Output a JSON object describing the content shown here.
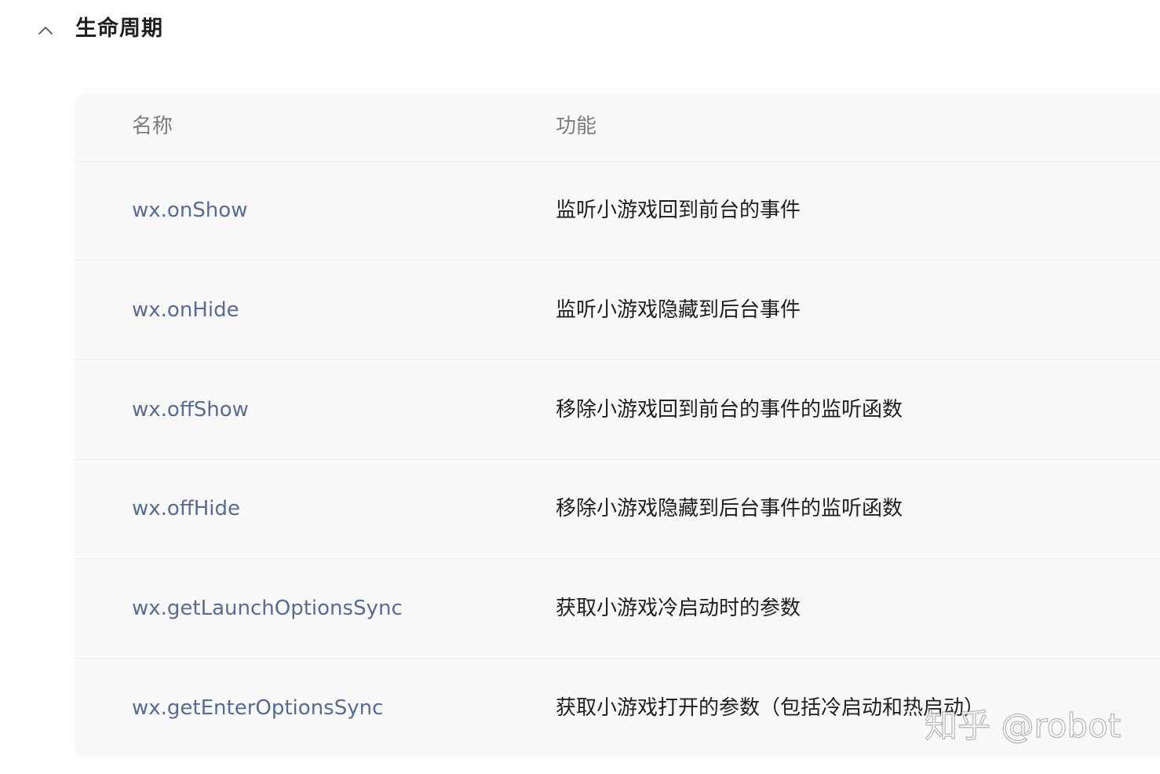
{
  "section": {
    "title": "生命周期",
    "toggle_icon": "chevron-up-icon"
  },
  "table": {
    "headers": {
      "name": "名称",
      "function": "功能"
    },
    "rows": [
      {
        "name": "wx.onShow",
        "function": "监听小游戏回到前台的事件"
      },
      {
        "name": "wx.onHide",
        "function": "监听小游戏隐藏到后台事件"
      },
      {
        "name": "wx.offShow",
        "function": "移除小游戏回到前台的事件的监听函数"
      },
      {
        "name": "wx.offHide",
        "function": "移除小游戏隐藏到后台事件的监听函数"
      },
      {
        "name": "wx.getLaunchOptionsSync",
        "function": "获取小游戏冷启动时的参数"
      },
      {
        "name": "wx.getEnterOptionsSync",
        "function": "获取小游戏打开的参数（包括冷启动和热启动）"
      }
    ]
  },
  "watermark": "知乎 @robot",
  "colors": {
    "link": "#576b95",
    "text": "#1f1f1f",
    "header_text": "#7d7d7d",
    "table_bg": "#f9f9f9",
    "divider": "#ebebeb"
  }
}
